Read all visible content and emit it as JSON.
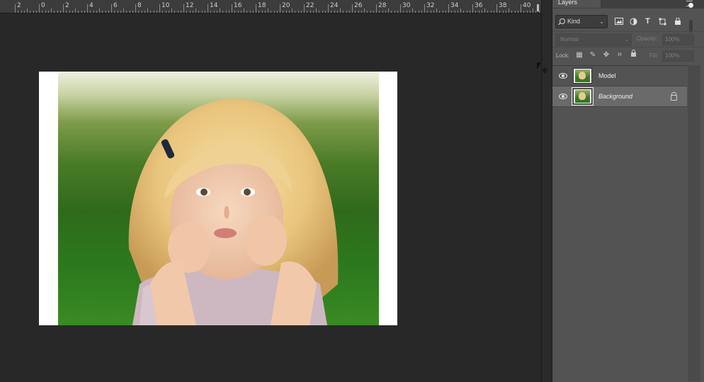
{
  "ruler": {
    "labels": [
      "2",
      "0",
      "2",
      "4",
      "6",
      "8",
      "10",
      "12",
      "14",
      "16",
      "18",
      "20",
      "22",
      "24",
      "26",
      "28",
      "30",
      "32",
      "34",
      "36",
      "38",
      "40"
    ]
  },
  "canvas": {
    "document_background": "#ffffff",
    "photo_subject": "child-in-grass-photo"
  },
  "layers_panel": {
    "tab_label": "Layers",
    "filter": {
      "kind_label": "Kind",
      "icons": [
        "pixel-filter-icon",
        "adjustment-filter-icon",
        "type-filter-icon",
        "shape-filter-icon",
        "smart-object-filter-icon"
      ]
    },
    "blend_mode": "Normal",
    "opacity_label": "Opacity:",
    "opacity_value": "100%",
    "lock_label": "Lock:",
    "fill_label": "Fill:",
    "fill_value": "100%",
    "layers": [
      {
        "name": "Model",
        "visible": true,
        "locked": false,
        "active": false
      },
      {
        "name": "Background",
        "visible": true,
        "locked": true,
        "active": true
      }
    ]
  },
  "colors": {
    "workspace_bg": "#282828",
    "panel_bg": "#535353",
    "active_layer_bg": "#6a6a6a"
  }
}
